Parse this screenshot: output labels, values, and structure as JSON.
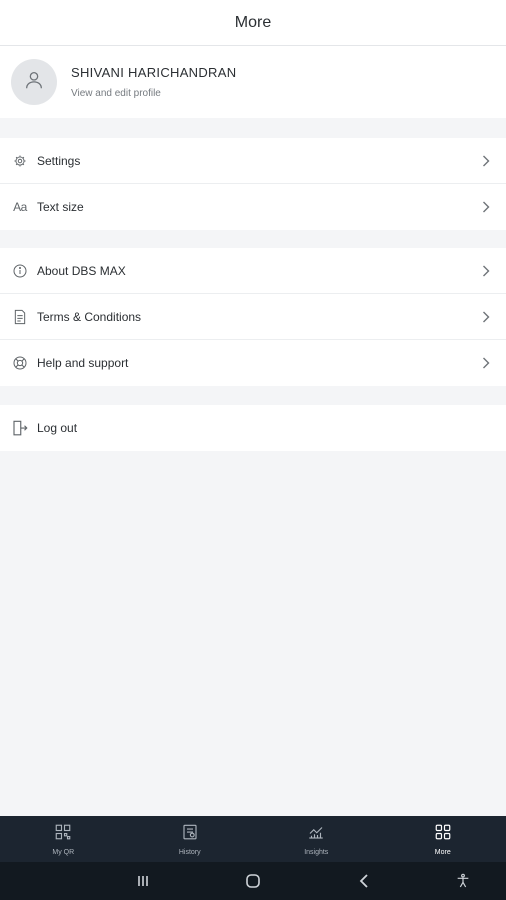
{
  "header": {
    "title": "More"
  },
  "profile": {
    "name": "SHIVANI HARICHANDRAN",
    "subtitle": "View and edit profile",
    "avatar_icon": "user-icon"
  },
  "groups": [
    {
      "items": [
        {
          "label": "Settings",
          "icon": "gear-icon"
        },
        {
          "label": "Text size",
          "icon": "text-size-icon",
          "icon_text": "Aa"
        }
      ]
    },
    {
      "items": [
        {
          "label": "About DBS MAX",
          "icon": "info-icon"
        },
        {
          "label": "Terms & Conditions",
          "icon": "document-icon"
        },
        {
          "label": "Help and support",
          "icon": "lifebuoy-icon"
        }
      ]
    },
    {
      "items": [
        {
          "label": "Log out",
          "icon": "logout-icon"
        }
      ]
    }
  ],
  "tabbar": {
    "tabs": [
      {
        "label": "My QR",
        "icon": "qr-icon",
        "active": false
      },
      {
        "label": "History",
        "icon": "history-icon",
        "active": false
      },
      {
        "label": "Insights",
        "icon": "insights-icon",
        "active": false
      },
      {
        "label": "More",
        "icon": "grid-icon",
        "active": true
      }
    ]
  },
  "colors": {
    "tabbar_bg": "#1c2530",
    "system_nav_bg": "#121920",
    "page_bg": "#f4f5f7"
  }
}
